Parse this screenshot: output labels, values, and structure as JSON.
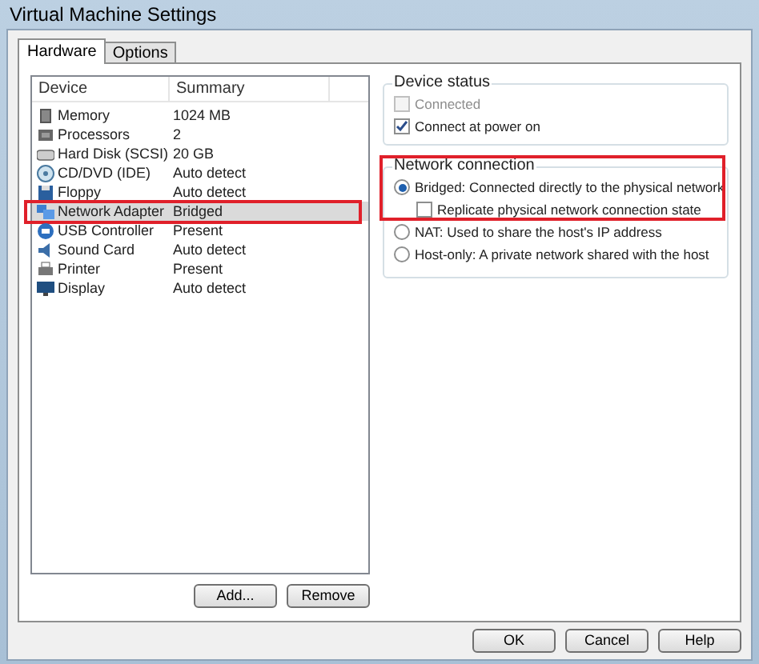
{
  "window": {
    "title": "Virtual Machine Settings"
  },
  "tabs": [
    {
      "label": "Hardware",
      "selected": true
    },
    {
      "label": "Options",
      "selected": false
    }
  ],
  "device_list": {
    "columns": [
      "Device",
      "Summary"
    ],
    "rows": [
      {
        "device": "Memory",
        "summary": "1024 MB",
        "selected": false,
        "highlighted": false
      },
      {
        "device": "Processors",
        "summary": "2",
        "selected": false,
        "highlighted": false
      },
      {
        "device": "Hard Disk (SCSI)",
        "summary": "20 GB",
        "selected": false,
        "highlighted": false
      },
      {
        "device": "CD/DVD (IDE)",
        "summary": "Auto detect",
        "selected": false,
        "highlighted": false
      },
      {
        "device": "Floppy",
        "summary": "Auto detect",
        "selected": false,
        "highlighted": false
      },
      {
        "device": "Network Adapter",
        "summary": "Bridged",
        "selected": true,
        "highlighted": true
      },
      {
        "device": "USB Controller",
        "summary": "Present",
        "selected": false,
        "highlighted": false
      },
      {
        "device": "Sound Card",
        "summary": "Auto detect",
        "selected": false,
        "highlighted": false
      },
      {
        "device": "Printer",
        "summary": "Present",
        "selected": false,
        "highlighted": false
      },
      {
        "device": "Display",
        "summary": "Auto detect",
        "selected": false,
        "highlighted": false
      }
    ]
  },
  "list_buttons": [
    "Add...",
    "Remove"
  ],
  "device_status": {
    "title": "Device status",
    "options": [
      {
        "label": "Connected",
        "checked": false,
        "disabled": true
      },
      {
        "label": "Connect at power on",
        "checked": true,
        "disabled": false
      }
    ]
  },
  "network_connection": {
    "title": "Network connection",
    "highlighted": true,
    "options": [
      {
        "kind": "radio",
        "label": "Bridged: Connected directly to the physical network",
        "selected": true
      },
      {
        "kind": "checkbox",
        "label": "Replicate physical network connection state",
        "checked": false
      },
      {
        "kind": "radio",
        "label": "NAT: Used to share the host's IP address",
        "selected": false
      },
      {
        "kind": "radio",
        "label": "Host-only: A private network shared with the host",
        "selected": false
      }
    ]
  },
  "dialog_buttons": [
    "OK",
    "Cancel",
    "Help"
  ]
}
